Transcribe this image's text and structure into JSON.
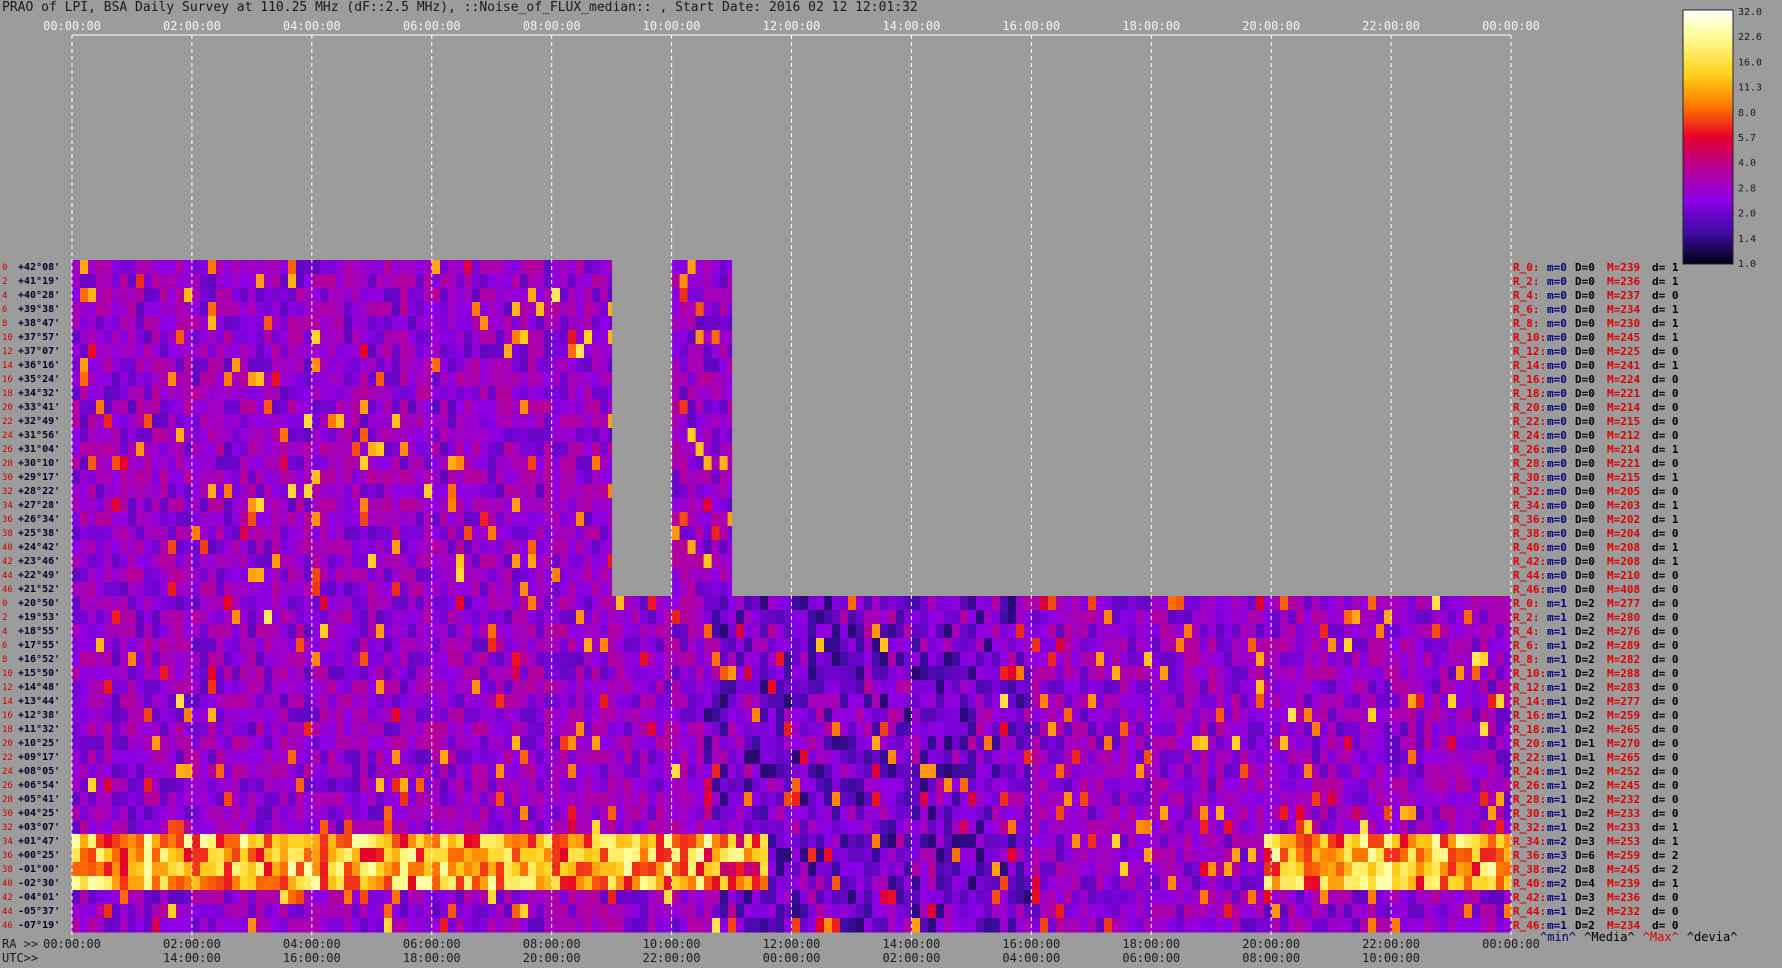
{
  "title": "PRAO of LPI, BSA Daily Survey at 110.25 MHz (dF::2.5 MHz), ::Noise_of_FLUX_median:: , Start Date: 2016 02 12 12:01:32",
  "colors": {
    "background": "#9c9c9c",
    "grid": "#ffffff"
  },
  "axes": {
    "ra_label": "RA >>",
    "utc_label": "UTC>>",
    "top_ticks": [
      "00:00:00",
      "02:00:00",
      "04:00:00",
      "06:00:00",
      "08:00:00",
      "10:00:00",
      "12:00:00",
      "14:00:00",
      "16:00:00",
      "18:00:00",
      "20:00:00",
      "22:00:00",
      "00:00:00"
    ],
    "bottom_ra_ticks": [
      "00:00:00",
      "02:00:00",
      "04:00:00",
      "06:00:00",
      "08:00:00",
      "10:00:00",
      "12:00:00",
      "14:00:00",
      "16:00:00",
      "18:00:00",
      "20:00:00",
      "22:00:00",
      "00:00:00"
    ],
    "bottom_utc_ticks": [
      "14:00:00",
      "16:00:00",
      "18:00:00",
      "20:00:00",
      "22:00:00",
      "00:00:00",
      "02:00:00",
      "04:00:00",
      "06:00:00",
      "08:00:00",
      "10:00:00"
    ]
  },
  "legend_stats": [
    {
      "text": "^min^",
      "color": "#00007a"
    },
    {
      "text": "^Media^",
      "color": "#000000"
    },
    {
      "text": "^Max^",
      "color": "#e00000"
    },
    {
      "text": "^devia^",
      "color": "#000000"
    }
  ],
  "chart_data": {
    "type": "heatmap",
    "title": "PRAO of LPI, BSA Daily Survey at 110.25 MHz (dF::2.5 MHz), ::Noise_of_FLUX_median:: , Start Date: 2016 02 12 12:01:32",
    "x_axis": {
      "label": "RA >>",
      "range_hours": [
        0,
        24
      ]
    },
    "colorbar": {
      "ticks": [
        "32.0",
        "22.6",
        "16.0",
        "11.3",
        "8.0",
        "5.7",
        "4.0",
        "2.8",
        "2.0",
        "1.4",
        "1.0"
      ],
      "scale": "log",
      "range": [
        1.0,
        32.0
      ]
    },
    "row_indices": [
      "0",
      "2",
      "4",
      "6",
      "8",
      "10",
      "12",
      "14",
      "16",
      "18",
      "20",
      "22",
      "24",
      "26",
      "28",
      "30",
      "32",
      "34",
      "36",
      "38",
      "40",
      "42",
      "44",
      "46",
      "0",
      "2",
      "4",
      "6",
      "8",
      "10",
      "12",
      "14",
      "16",
      "18",
      "20",
      "22",
      "24",
      "26",
      "28",
      "30",
      "32",
      "34",
      "36",
      "38",
      "40",
      "42",
      "44",
      "46"
    ],
    "declinations": [
      "+42°08'",
      "+41°19'",
      "+40°28'",
      "+39°38'",
      "+38°47'",
      "+37°57'",
      "+37°07'",
      "+36°16'",
      "+35°24'",
      "+34°32'",
      "+33°41'",
      "+32°49'",
      "+31°56'",
      "+31°04'",
      "+30°10'",
      "+29°17'",
      "+28°22'",
      "+27°28'",
      "+26°34'",
      "+25°38'",
      "+24°42'",
      "+23°46'",
      "+22°49'",
      "+21°52'",
      "+20°50'",
      "+19°53'",
      "+18°55'",
      "+17°55'",
      "+16°52'",
      "+15°50'",
      "+14°48'",
      "+13°44'",
      "+12°38'",
      "+11°32'",
      "+10°25'",
      "+09°17'",
      "+08°05'",
      "+06°54'",
      "+05°41'",
      "+04°25'",
      "+03°07'",
      "+01°47'",
      "+00°25'",
      "-01°00'",
      "-02°30'",
      "-04°01'",
      "-05°37'",
      "-07°19'"
    ],
    "beam_stats": [
      {
        "name": "R_0:",
        "m": "m=0",
        "D": "D=0",
        "M": "M=239",
        "d": "d= 1"
      },
      {
        "name": "R_2:",
        "m": "m=0",
        "D": "D=0",
        "M": "M=236",
        "d": "d= 1"
      },
      {
        "name": "R_4:",
        "m": "m=0",
        "D": "D=0",
        "M": "M=237",
        "d": "d= 0"
      },
      {
        "name": "R_6:",
        "m": "m=0",
        "D": "D=0",
        "M": "M=234",
        "d": "d= 1"
      },
      {
        "name": "R_8:",
        "m": "m=0",
        "D": "D=0",
        "M": "M=230",
        "d": "d= 1"
      },
      {
        "name": "R_10:",
        "m": "m=0",
        "D": "D=0",
        "M": "M=245",
        "d": "d= 1"
      },
      {
        "name": "R_12:",
        "m": "m=0",
        "D": "D=0",
        "M": "M=225",
        "d": "d= 0"
      },
      {
        "name": "R_14:",
        "m": "m=0",
        "D": "D=0",
        "M": "M=241",
        "d": "d= 1"
      },
      {
        "name": "R_16:",
        "m": "m=0",
        "D": "D=0",
        "M": "M=224",
        "d": "d= 0"
      },
      {
        "name": "R_18:",
        "m": "m=0",
        "D": "D=0",
        "M": "M=221",
        "d": "d= 0"
      },
      {
        "name": "R_20:",
        "m": "m=0",
        "D": "D=0",
        "M": "M=214",
        "d": "d= 0"
      },
      {
        "name": "R_22:",
        "m": "m=0",
        "D": "D=0",
        "M": "M=215",
        "d": "d= 0"
      },
      {
        "name": "R_24:",
        "m": "m=0",
        "D": "D=0",
        "M": "M=212",
        "d": "d= 0"
      },
      {
        "name": "R_26:",
        "m": "m=0",
        "D": "D=0",
        "M": "M=214",
        "d": "d= 1"
      },
      {
        "name": "R_28:",
        "m": "m=0",
        "D": "D=0",
        "M": "M=221",
        "d": "d= 0"
      },
      {
        "name": "R_30:",
        "m": "m=0",
        "D": "D=0",
        "M": "M=215",
        "d": "d= 1"
      },
      {
        "name": "R_32:",
        "m": "m=0",
        "D": "D=0",
        "M": "M=205",
        "d": "d= 0"
      },
      {
        "name": "R_34:",
        "m": "m=0",
        "D": "D=0",
        "M": "M=203",
        "d": "d= 1"
      },
      {
        "name": "R_36:",
        "m": "m=0",
        "D": "D=0",
        "M": "M=202",
        "d": "d= 1"
      },
      {
        "name": "R_38:",
        "m": "m=0",
        "D": "D=0",
        "M": "M=204",
        "d": "d= 0"
      },
      {
        "name": "R_40:",
        "m": "m=0",
        "D": "D=0",
        "M": "M=208",
        "d": "d= 1"
      },
      {
        "name": "R_42:",
        "m": "m=0",
        "D": "D=0",
        "M": "M=208",
        "d": "d= 1"
      },
      {
        "name": "R_44:",
        "m": "m=0",
        "D": "D=0",
        "M": "M=210",
        "d": "d= 0"
      },
      {
        "name": "R_46:",
        "m": "m=0",
        "D": "D=0",
        "M": "M=408",
        "d": "d= 0"
      },
      {
        "name": "R_0:",
        "m": "m=1",
        "D": "D=2",
        "M": "M=277",
        "d": "d= 0"
      },
      {
        "name": "R_2:",
        "m": "m=1",
        "D": "D=2",
        "M": "M=280",
        "d": "d= 0"
      },
      {
        "name": "R_4:",
        "m": "m=1",
        "D": "D=2",
        "M": "M=276",
        "d": "d= 0"
      },
      {
        "name": "R_6:",
        "m": "m=1",
        "D": "D=2",
        "M": "M=289",
        "d": "d= 0"
      },
      {
        "name": "R_8:",
        "m": "m=1",
        "D": "D=2",
        "M": "M=282",
        "d": "d= 0"
      },
      {
        "name": "R_10:",
        "m": "m=1",
        "D": "D=2",
        "M": "M=288",
        "d": "d= 0"
      },
      {
        "name": "R_12:",
        "m": "m=1",
        "D": "D=2",
        "M": "M=283",
        "d": "d= 0"
      },
      {
        "name": "R_14:",
        "m": "m=1",
        "D": "D=2",
        "M": "M=277",
        "d": "d= 0"
      },
      {
        "name": "R_16:",
        "m": "m=1",
        "D": "D=2",
        "M": "M=259",
        "d": "d= 0"
      },
      {
        "name": "R_18:",
        "m": "m=1",
        "D": "D=2",
        "M": "M=265",
        "d": "d= 0"
      },
      {
        "name": "R_20:",
        "m": "m=1",
        "D": "D=1",
        "M": "M=270",
        "d": "d= 0"
      },
      {
        "name": "R_22:",
        "m": "m=1",
        "D": "D=1",
        "M": "M=265",
        "d": "d= 0"
      },
      {
        "name": "R_24:",
        "m": "m=1",
        "D": "D=2",
        "M": "M=252",
        "d": "d= 0"
      },
      {
        "name": "R_26:",
        "m": "m=1",
        "D": "D=2",
        "M": "M=245",
        "d": "d= 0"
      },
      {
        "name": "R_28:",
        "m": "m=1",
        "D": "D=2",
        "M": "M=232",
        "d": "d= 0"
      },
      {
        "name": "R_30:",
        "m": "m=1",
        "D": "D=2",
        "M": "M=233",
        "d": "d= 0"
      },
      {
        "name": "R_32:",
        "m": "m=1",
        "D": "D=2",
        "M": "M=233",
        "d": "d= 1"
      },
      {
        "name": "R_34:",
        "m": "m=2",
        "D": "D=3",
        "M": "M=253",
        "d": "d= 1"
      },
      {
        "name": "R_36:",
        "m": "m=3",
        "D": "D=6",
        "M": "M=259",
        "d": "d= 2"
      },
      {
        "name": "R_38:",
        "m": "m=2",
        "D": "D=8",
        "M": "M=245",
        "d": "d= 2"
      },
      {
        "name": "R_40:",
        "m": "m=2",
        "D": "D=4",
        "M": "M=239",
        "d": "d= 1"
      },
      {
        "name": "R_42:",
        "m": "m=1",
        "D": "D=3",
        "M": "M=236",
        "d": "d= 0"
      },
      {
        "name": "R_44:",
        "m": "m=1",
        "D": "D=2",
        "M": "M=232",
        "d": "d= 0"
      },
      {
        "name": "R_46:",
        "m": "m=1",
        "D": "D=2",
        "M": "M=234",
        "d": "d= 0"
      }
    ],
    "observed_ra_hours": {
      "upper_group": [
        [
          0,
          9.0
        ],
        [
          10.0,
          11.0
        ]
      ],
      "lower_group": [
        [
          0,
          24.0
        ]
      ]
    },
    "notes_values": {
      "bright_band_dec": [
        "+01°47'",
        "-02°30'"
      ],
      "bright_band_ra_hours": [
        [
          0,
          11.5
        ],
        [
          19.8,
          24.0
        ]
      ]
    }
  }
}
